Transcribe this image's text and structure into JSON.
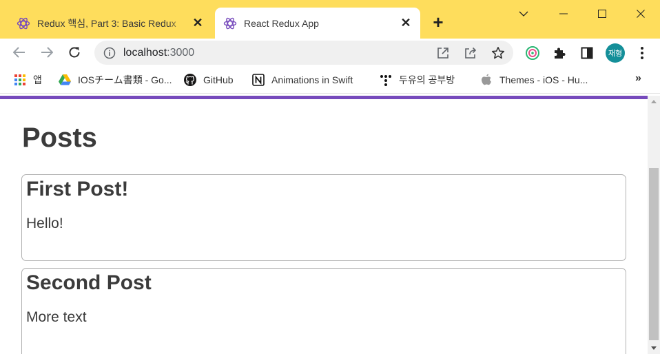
{
  "browser": {
    "tabs": [
      {
        "title": "Redux 핵심, Part 3: Basic Redux",
        "active": false
      },
      {
        "title": "React Redux App",
        "active": true
      }
    ],
    "address": {
      "host": "localhost",
      "port": ":3000"
    },
    "avatar_label": "재형",
    "bookmarks": [
      {
        "label": "앱",
        "icon": "apps-grid-icon"
      },
      {
        "label": "IOSチーム書類 - Go...",
        "icon": "google-drive-icon"
      },
      {
        "label": "GitHub",
        "icon": "github-icon"
      },
      {
        "label": "Animations in Swift",
        "icon": "notion-icon"
      },
      {
        "label": "두유의 공부방",
        "icon": "dots-icon"
      },
      {
        "label": "Themes - iOS - Hu...",
        "icon": "apple-icon"
      }
    ],
    "bookmarks_more": "»",
    "colors": {
      "tabstrip": "#fedd5c",
      "accent": "#764abc",
      "avatar": "#148f99"
    }
  },
  "page": {
    "title": "Posts",
    "posts": [
      {
        "title": "First Post!",
        "content": "Hello!"
      },
      {
        "title": "Second Post",
        "content": "More text"
      }
    ]
  }
}
